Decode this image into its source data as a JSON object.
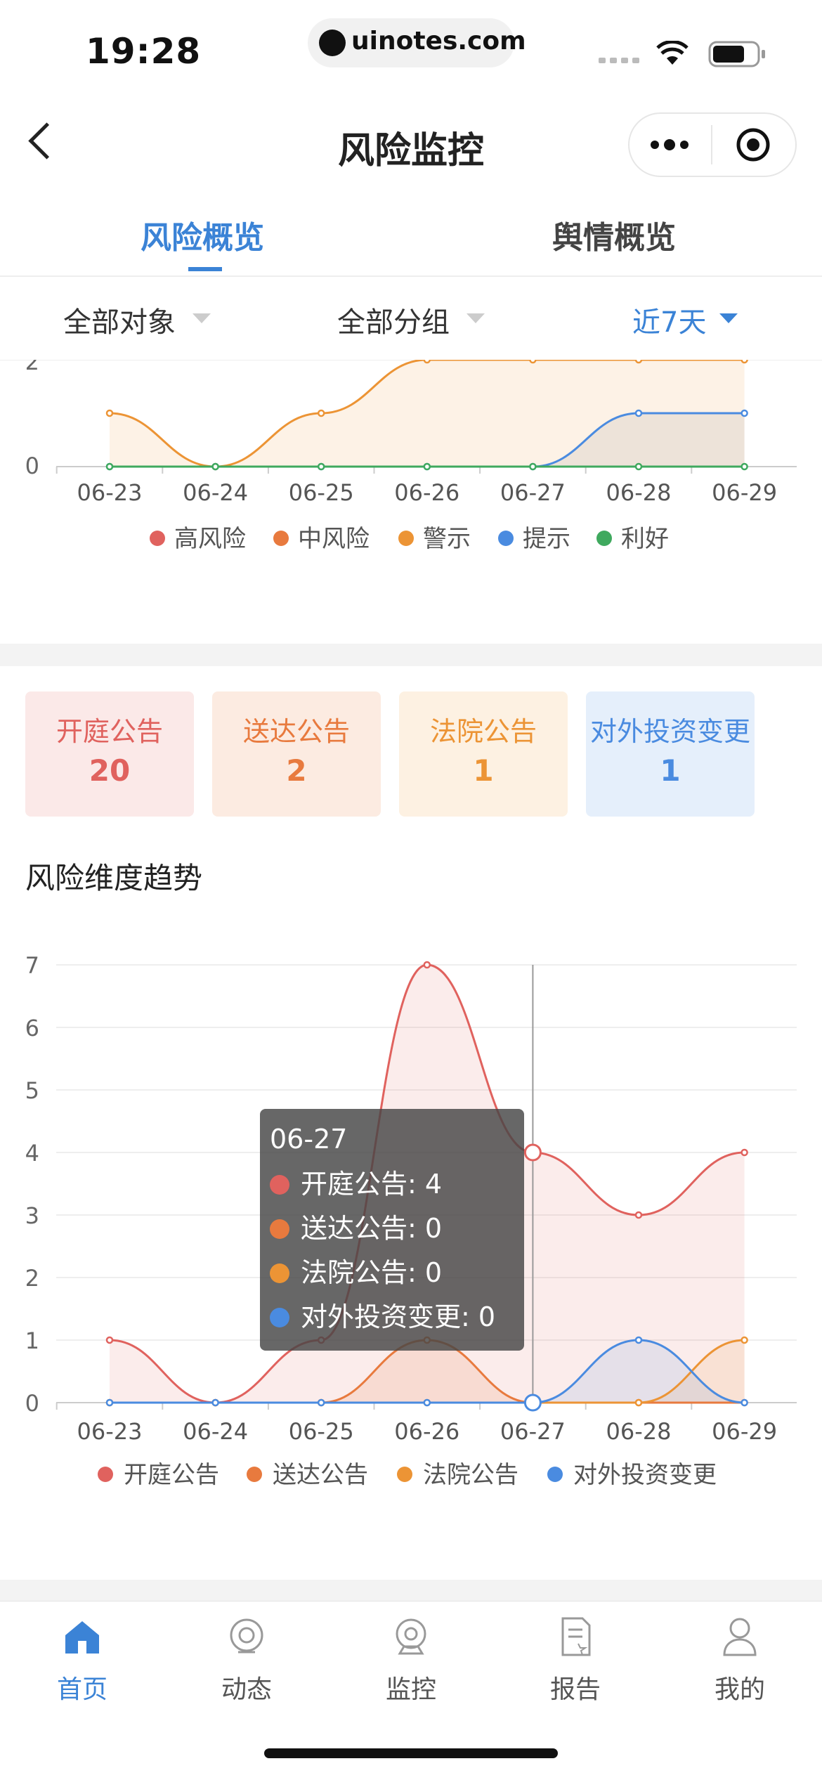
{
  "status_bar": {
    "time": "19:28",
    "url": "uinotes.com"
  },
  "nav": {
    "title": "风险监控"
  },
  "tabs": [
    {
      "label": "风险概览",
      "active": true
    },
    {
      "label": "舆情概览",
      "active": false
    }
  ],
  "filters": [
    {
      "label": "全部对象",
      "active": false
    },
    {
      "label": "全部分组",
      "active": false
    },
    {
      "label": "近7天",
      "active": true
    }
  ],
  "colors": {
    "accent": "#3b83d6",
    "red": "#e0625e",
    "orange": "#e87a3e",
    "amber": "#ec9435",
    "blue": "#4a8be0",
    "green": "#3fa95e"
  },
  "chart_data": [
    {
      "type": "line",
      "categories": [
        "06-23",
        "06-24",
        "06-25",
        "06-26",
        "06-27",
        "06-28",
        "06-29"
      ],
      "visible_y_ticks": [
        "0",
        "2"
      ],
      "series": [
        {
          "name": "高风险",
          "color": "#e0625e",
          "values": [
            null,
            null,
            null,
            null,
            null,
            null,
            null
          ]
        },
        {
          "name": "中风险",
          "color": "#e87a3e",
          "values": [
            null,
            null,
            null,
            null,
            null,
            null,
            null
          ]
        },
        {
          "name": "警示",
          "color": "#ec9435",
          "values": [
            1,
            0,
            1,
            2,
            2,
            2,
            2
          ]
        },
        {
          "name": "提示",
          "color": "#4a8be0",
          "values": [
            0,
            0,
            0,
            0,
            0,
            1,
            1
          ]
        },
        {
          "name": "利好",
          "color": "#3fa95e",
          "values": [
            0,
            0,
            0,
            0,
            0,
            0,
            0
          ]
        }
      ]
    },
    {
      "type": "line",
      "categories": [
        "06-23",
        "06-24",
        "06-25",
        "06-26",
        "06-27",
        "06-28",
        "06-29"
      ],
      "ylim": [
        0,
        7
      ],
      "y_ticks": [
        0,
        1,
        2,
        3,
        4,
        5,
        6,
        7
      ],
      "series": [
        {
          "name": "开庭公告",
          "color": "#e0625e",
          "values": [
            1,
            0,
            1,
            7,
            4,
            3,
            4
          ]
        },
        {
          "name": "送达公告",
          "color": "#e87a3e",
          "values": [
            0,
            0,
            0,
            1,
            0,
            0,
            0
          ]
        },
        {
          "name": "法院公告",
          "color": "#ec9435",
          "values": [
            0,
            0,
            0,
            0,
            0,
            0,
            1
          ]
        },
        {
          "name": "对外投资变更",
          "color": "#4a8be0",
          "values": [
            0,
            0,
            0,
            0,
            0,
            1,
            0
          ]
        }
      ],
      "tooltip": {
        "category": "06-27",
        "rows": [
          "开庭公告: 4",
          "送达公告: 0",
          "法院公告: 0",
          "对外投资变更: 0"
        ]
      }
    }
  ],
  "cards": [
    {
      "label": "开庭公告",
      "value": "20",
      "color": "#e0625e",
      "bg": "#fbe9e8"
    },
    {
      "label": "送达公告",
      "value": "2",
      "color": "#e87a3e",
      "bg": "#fcebe1"
    },
    {
      "label": "法院公告",
      "value": "1",
      "color": "#ec9435",
      "bg": "#fdf1e2"
    },
    {
      "label": "对外投资变更",
      "value": "1",
      "color": "#4a8be0",
      "bg": "#e5effb"
    }
  ],
  "trend_title": "风险维度趋势",
  "bottom_tabs": [
    {
      "label": "首页",
      "icon": "home-icon",
      "active": true
    },
    {
      "label": "动态",
      "icon": "activity-icon",
      "active": false
    },
    {
      "label": "监控",
      "icon": "camera-icon",
      "active": false
    },
    {
      "label": "报告",
      "icon": "report-icon",
      "active": false
    },
    {
      "label": "我的",
      "icon": "user-icon",
      "active": false
    }
  ]
}
